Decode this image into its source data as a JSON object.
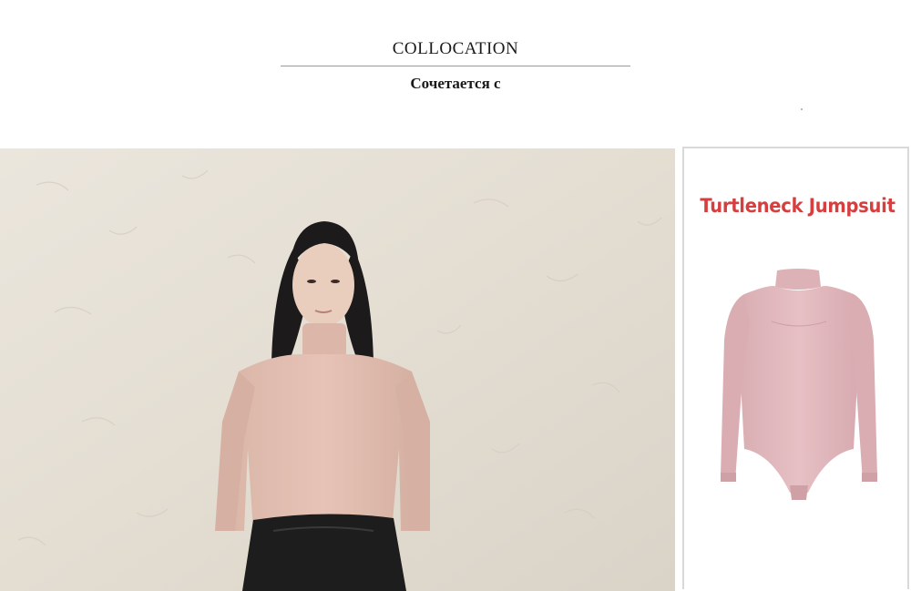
{
  "header": {
    "title": "COLLOCATION",
    "subtitle": "Сочетается с"
  },
  "product_panel": {
    "label": "Turtleneck Jumpsuit"
  },
  "colors": {
    "label_red": "#d63f3f",
    "garment_pink": "#e2b9bd",
    "rule_gray": "#9a9a9a"
  }
}
